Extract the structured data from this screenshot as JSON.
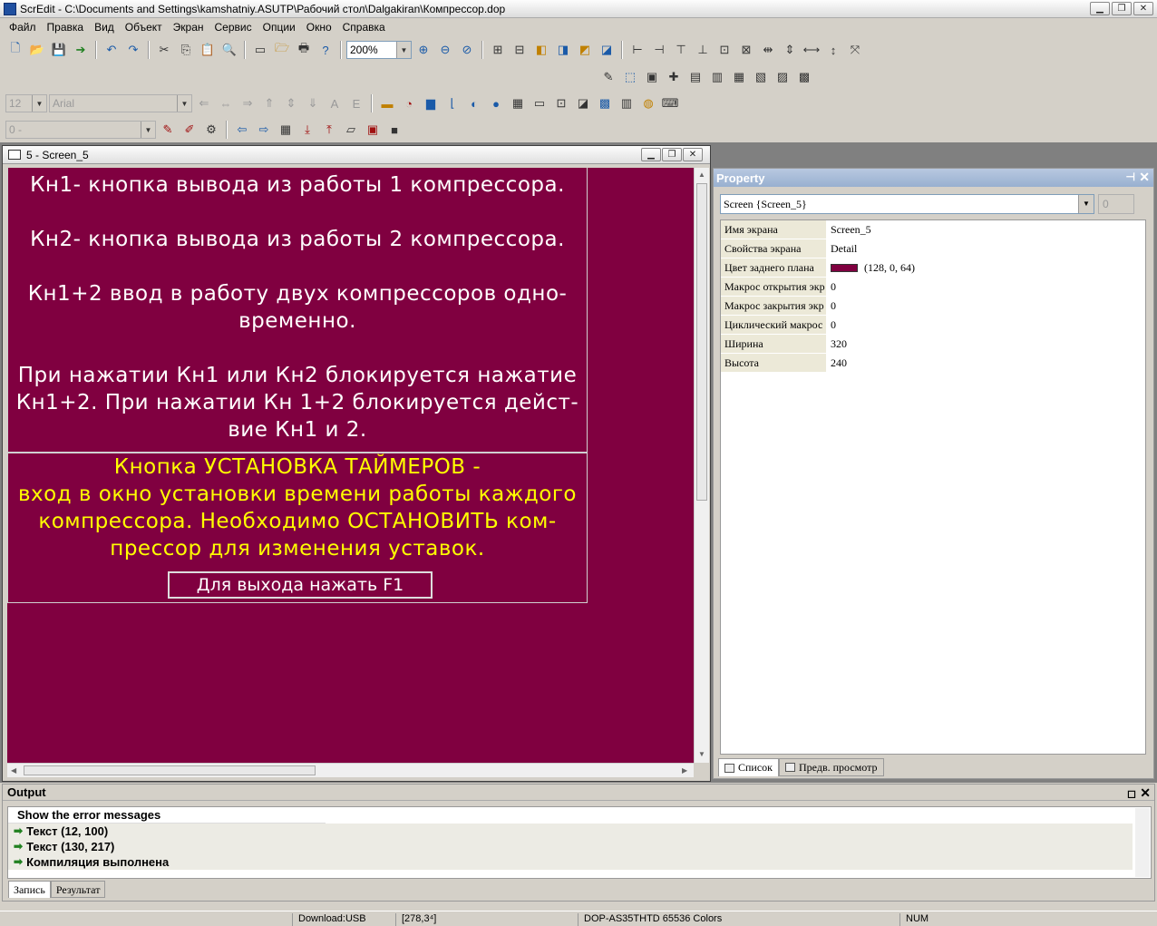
{
  "window": {
    "title": "ScrEdit - C:\\Documents and Settings\\kamshatniy.ASUTP\\Рабочий стол\\Dalgakiran\\Компрессор.dop"
  },
  "menu": [
    "Файл",
    "Правка",
    "Вид",
    "Объект",
    "Экран",
    "Сервис",
    "Опции",
    "Окно",
    "Справка"
  ],
  "toolbar": {
    "zoom": "200%",
    "font_size": "12",
    "font_name": "Arial",
    "layer_value": "0 -"
  },
  "child_window": {
    "title": "5 - Screen_5"
  },
  "screen": {
    "background": "#800040",
    "lines_white": [
      "Кн1- кнопка вывода из работы 1 компрессора.",
      "Кн2- кнопка вывода из работы 2 компрессора.",
      "Кн1+2 ввод в работу двух компрессоров одно-",
      "временно.",
      "При нажатии Кн1 или Кн2 блокируется нажатие",
      "Кн1+2. При нажатии Кн 1+2 блокируется дейст-",
      "вие Кн1 и 2."
    ],
    "lines_yellow": [
      "Кнопка УСТАНОВКА ТАЙМЕРОВ -",
      "вход в окно установки времени работы каждого",
      "компрессора. Необходимо ОСТАНОВИТЬ ком-",
      "прессор для изменения уставок."
    ],
    "exit_button": "Для выхода нажать F1"
  },
  "property": {
    "title": "Property",
    "object": "Screen {Screen_5}",
    "spin": "0",
    "rows": [
      {
        "key": "Имя экрана",
        "value": "Screen_5"
      },
      {
        "key": "Свойства экрана",
        "value": "Detail"
      },
      {
        "key": "Цвет заднего плана",
        "value": "(128, 0, 64)"
      },
      {
        "key": "Макрос открытия экр",
        "value": "0"
      },
      {
        "key": "Макрос закрытия экр",
        "value": "0"
      },
      {
        "key": "Циклический макрос :",
        "value": "0"
      },
      {
        "key": "Ширина",
        "value": "320"
      },
      {
        "key": "Высота",
        "value": "240"
      }
    ],
    "swatch_color": "#800040",
    "tabs": [
      "Список",
      "Предв. просмотр"
    ]
  },
  "output": {
    "title": "Output",
    "header": "Show the error messages",
    "rows": [
      "Текст (12, 100)",
      "Текст (130, 217)",
      "Компиляция выполнена"
    ],
    "tabs": [
      "Запись",
      "Результат"
    ]
  },
  "status": {
    "download": "Download:USB",
    "coords": "[278,3⁴]",
    "device": "DOP-AS35THTD 65536 Colors",
    "num": "NUM"
  }
}
